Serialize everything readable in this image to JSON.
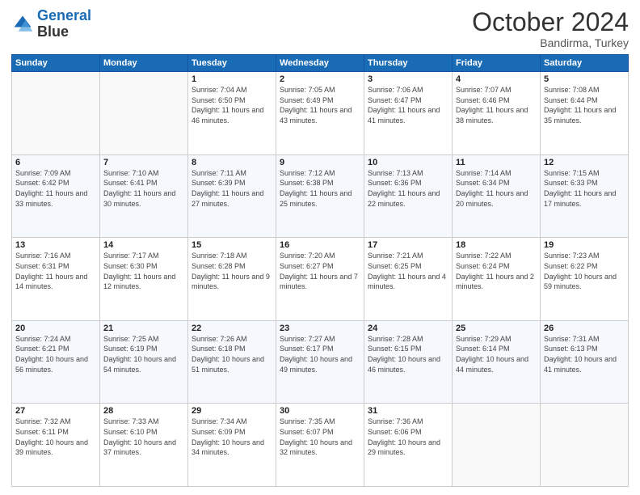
{
  "header": {
    "logo_line1": "General",
    "logo_line2": "Blue",
    "main_title": "October 2024",
    "subtitle": "Bandirma, Turkey"
  },
  "weekdays": [
    "Sunday",
    "Monday",
    "Tuesday",
    "Wednesday",
    "Thursday",
    "Friday",
    "Saturday"
  ],
  "weeks": [
    [
      {
        "day": "",
        "detail": ""
      },
      {
        "day": "",
        "detail": ""
      },
      {
        "day": "1",
        "detail": "Sunrise: 7:04 AM\nSunset: 6:50 PM\nDaylight: 11 hours and 46 minutes."
      },
      {
        "day": "2",
        "detail": "Sunrise: 7:05 AM\nSunset: 6:49 PM\nDaylight: 11 hours and 43 minutes."
      },
      {
        "day": "3",
        "detail": "Sunrise: 7:06 AM\nSunset: 6:47 PM\nDaylight: 11 hours and 41 minutes."
      },
      {
        "day": "4",
        "detail": "Sunrise: 7:07 AM\nSunset: 6:46 PM\nDaylight: 11 hours and 38 minutes."
      },
      {
        "day": "5",
        "detail": "Sunrise: 7:08 AM\nSunset: 6:44 PM\nDaylight: 11 hours and 35 minutes."
      }
    ],
    [
      {
        "day": "6",
        "detail": "Sunrise: 7:09 AM\nSunset: 6:42 PM\nDaylight: 11 hours and 33 minutes."
      },
      {
        "day": "7",
        "detail": "Sunrise: 7:10 AM\nSunset: 6:41 PM\nDaylight: 11 hours and 30 minutes."
      },
      {
        "day": "8",
        "detail": "Sunrise: 7:11 AM\nSunset: 6:39 PM\nDaylight: 11 hours and 27 minutes."
      },
      {
        "day": "9",
        "detail": "Sunrise: 7:12 AM\nSunset: 6:38 PM\nDaylight: 11 hours and 25 minutes."
      },
      {
        "day": "10",
        "detail": "Sunrise: 7:13 AM\nSunset: 6:36 PM\nDaylight: 11 hours and 22 minutes."
      },
      {
        "day": "11",
        "detail": "Sunrise: 7:14 AM\nSunset: 6:34 PM\nDaylight: 11 hours and 20 minutes."
      },
      {
        "day": "12",
        "detail": "Sunrise: 7:15 AM\nSunset: 6:33 PM\nDaylight: 11 hours and 17 minutes."
      }
    ],
    [
      {
        "day": "13",
        "detail": "Sunrise: 7:16 AM\nSunset: 6:31 PM\nDaylight: 11 hours and 14 minutes."
      },
      {
        "day": "14",
        "detail": "Sunrise: 7:17 AM\nSunset: 6:30 PM\nDaylight: 11 hours and 12 minutes."
      },
      {
        "day": "15",
        "detail": "Sunrise: 7:18 AM\nSunset: 6:28 PM\nDaylight: 11 hours and 9 minutes."
      },
      {
        "day": "16",
        "detail": "Sunrise: 7:20 AM\nSunset: 6:27 PM\nDaylight: 11 hours and 7 minutes."
      },
      {
        "day": "17",
        "detail": "Sunrise: 7:21 AM\nSunset: 6:25 PM\nDaylight: 11 hours and 4 minutes."
      },
      {
        "day": "18",
        "detail": "Sunrise: 7:22 AM\nSunset: 6:24 PM\nDaylight: 11 hours and 2 minutes."
      },
      {
        "day": "19",
        "detail": "Sunrise: 7:23 AM\nSunset: 6:22 PM\nDaylight: 10 hours and 59 minutes."
      }
    ],
    [
      {
        "day": "20",
        "detail": "Sunrise: 7:24 AM\nSunset: 6:21 PM\nDaylight: 10 hours and 56 minutes."
      },
      {
        "day": "21",
        "detail": "Sunrise: 7:25 AM\nSunset: 6:19 PM\nDaylight: 10 hours and 54 minutes."
      },
      {
        "day": "22",
        "detail": "Sunrise: 7:26 AM\nSunset: 6:18 PM\nDaylight: 10 hours and 51 minutes."
      },
      {
        "day": "23",
        "detail": "Sunrise: 7:27 AM\nSunset: 6:17 PM\nDaylight: 10 hours and 49 minutes."
      },
      {
        "day": "24",
        "detail": "Sunrise: 7:28 AM\nSunset: 6:15 PM\nDaylight: 10 hours and 46 minutes."
      },
      {
        "day": "25",
        "detail": "Sunrise: 7:29 AM\nSunset: 6:14 PM\nDaylight: 10 hours and 44 minutes."
      },
      {
        "day": "26",
        "detail": "Sunrise: 7:31 AM\nSunset: 6:13 PM\nDaylight: 10 hours and 41 minutes."
      }
    ],
    [
      {
        "day": "27",
        "detail": "Sunrise: 7:32 AM\nSunset: 6:11 PM\nDaylight: 10 hours and 39 minutes."
      },
      {
        "day": "28",
        "detail": "Sunrise: 7:33 AM\nSunset: 6:10 PM\nDaylight: 10 hours and 37 minutes."
      },
      {
        "day": "29",
        "detail": "Sunrise: 7:34 AM\nSunset: 6:09 PM\nDaylight: 10 hours and 34 minutes."
      },
      {
        "day": "30",
        "detail": "Sunrise: 7:35 AM\nSunset: 6:07 PM\nDaylight: 10 hours and 32 minutes."
      },
      {
        "day": "31",
        "detail": "Sunrise: 7:36 AM\nSunset: 6:06 PM\nDaylight: 10 hours and 29 minutes."
      },
      {
        "day": "",
        "detail": ""
      },
      {
        "day": "",
        "detail": ""
      }
    ]
  ]
}
